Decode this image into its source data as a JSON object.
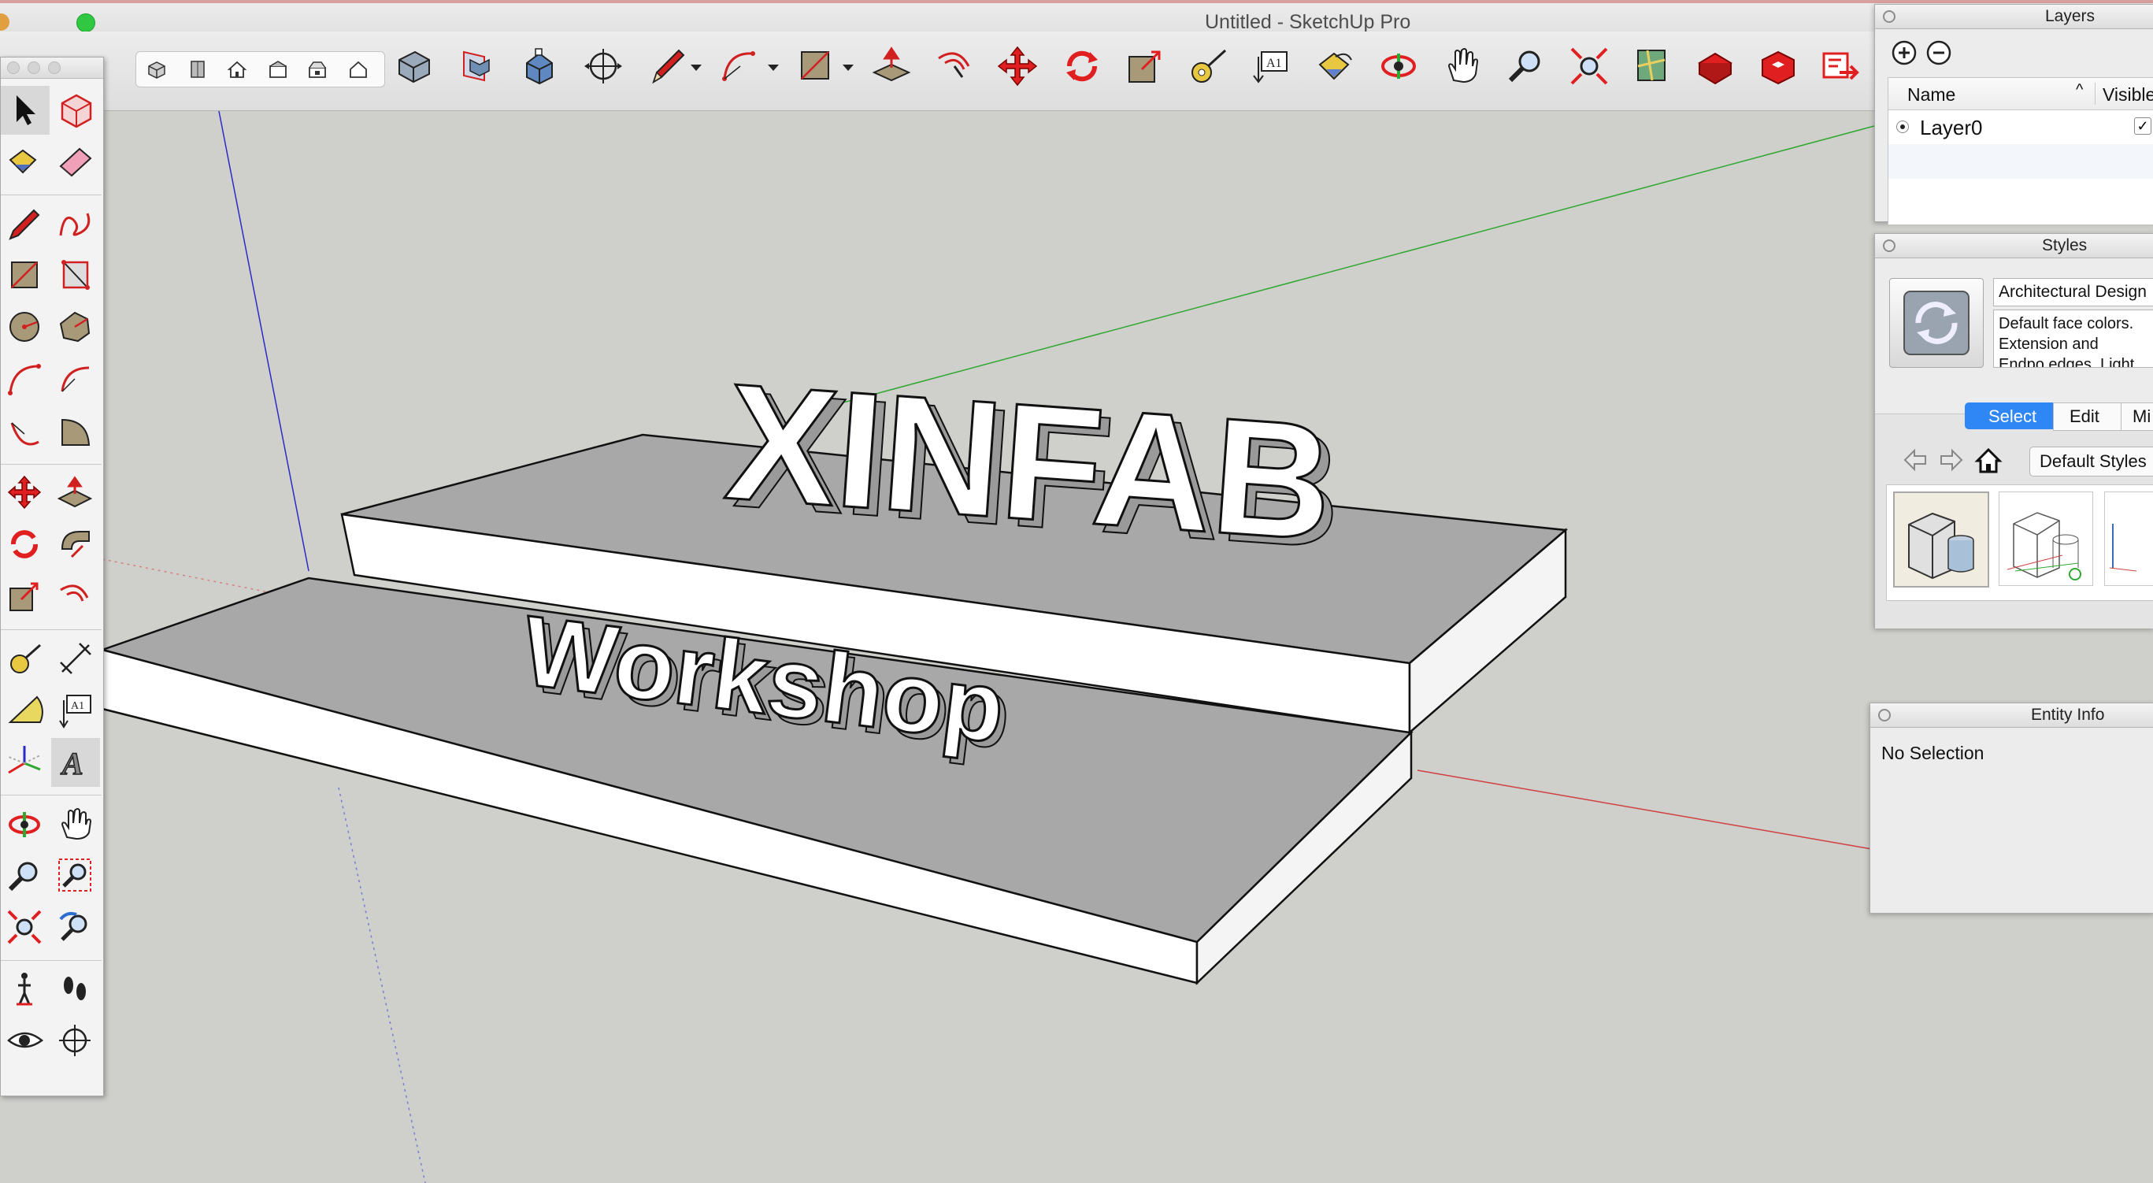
{
  "window": {
    "title": "Untitled - SketchUp Pro"
  },
  "viewport": {
    "heading_text": "XINFAB",
    "subheading_text": "Workshop"
  },
  "toolbar": {
    "tools": [
      "select-tool",
      "paint-bucket-tool",
      "eraser-tool",
      "line-tool",
      "arc-tool",
      "rectangle-tool",
      "push-pull-tool",
      "follow-me-tool",
      "move-tool",
      "rotate-tool",
      "scale-tool",
      "tape-measure-tool",
      "text-tool",
      "paint-tool",
      "orbit-tool",
      "pan-tool",
      "zoom-tool",
      "zoom-extents-tool",
      "add-location-tool",
      "3d-warehouse-tool",
      "extension-warehouse-tool",
      "layout-tool"
    ]
  },
  "layers_panel": {
    "title": "Layers",
    "col_name": "Name",
    "col_visible": "Visible",
    "rows": [
      {
        "name": "Layer0",
        "visible_mark": "✓"
      }
    ]
  },
  "styles_panel": {
    "title": "Styles",
    "style_name": "Architectural Design",
    "description": "Default face colors. Extension and Endpo edges. Light blue sk",
    "tabs": [
      "Select",
      "Edit",
      "Mi"
    ],
    "active_tab": "Select",
    "collection": "Default Styles"
  },
  "entity_info_panel": {
    "title": "Entity Info",
    "status": "No Selection"
  },
  "colors": {
    "accent": "#2f86f5",
    "axis_red": "#d04040",
    "axis_green": "#2fa82f",
    "axis_blue": "#2b2bc8"
  }
}
